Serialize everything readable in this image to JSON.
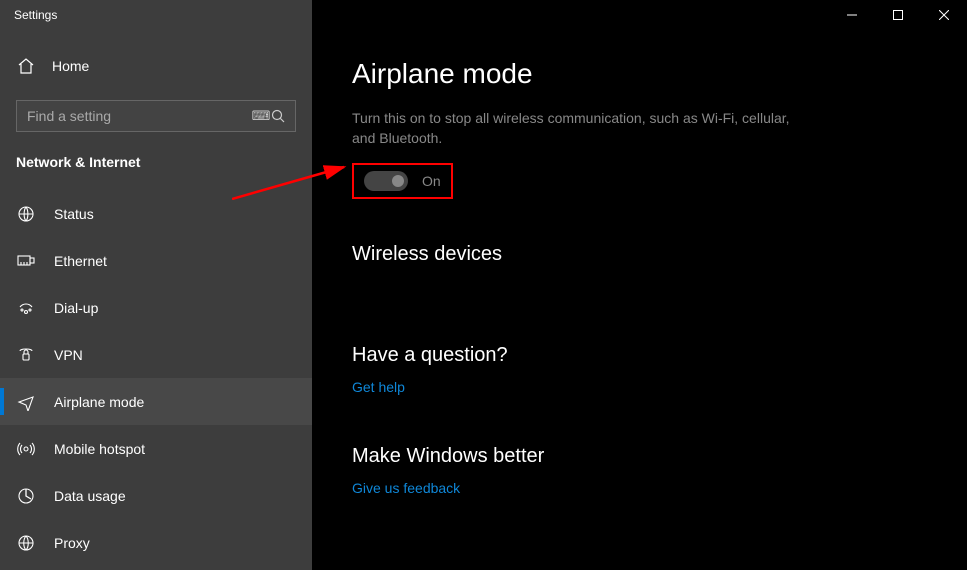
{
  "window": {
    "title": "Settings"
  },
  "sidebar": {
    "home": "Home",
    "search_placeholder": "Find a setting",
    "section": "Network & Internet",
    "items": [
      {
        "label": "Status",
        "icon": "status"
      },
      {
        "label": "Ethernet",
        "icon": "ethernet"
      },
      {
        "label": "Dial-up",
        "icon": "dialup"
      },
      {
        "label": "VPN",
        "icon": "vpn"
      },
      {
        "label": "Airplane mode",
        "icon": "airplane",
        "active": true
      },
      {
        "label": "Mobile hotspot",
        "icon": "hotspot"
      },
      {
        "label": "Data usage",
        "icon": "datausage"
      },
      {
        "label": "Proxy",
        "icon": "proxy"
      }
    ]
  },
  "main": {
    "title": "Airplane mode",
    "description": "Turn this on to stop all wireless communication, such as Wi-Fi, cellular, and Bluetooth.",
    "toggle_state": "On",
    "section_wireless": "Wireless devices",
    "question_heading": "Have a question?",
    "question_link": "Get help",
    "feedback_heading": "Make Windows better",
    "feedback_link": "Give us feedback"
  },
  "annotation": {
    "highlight": "airplane-toggle"
  }
}
